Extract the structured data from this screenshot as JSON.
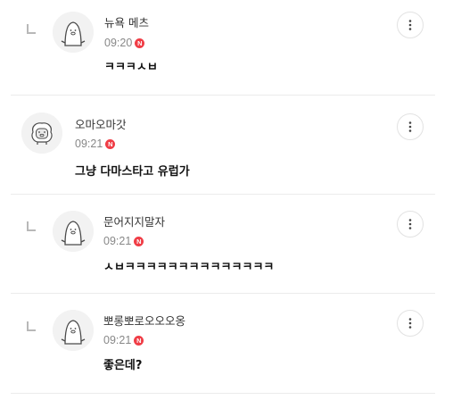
{
  "comments": [
    {
      "is_reply": true,
      "nickname": "뉴욕 메츠",
      "time": "09:20",
      "badge": "N",
      "text": "ㅋㅋㅋㅅㅂ",
      "avatar_icon": "penguin-avatar-icon",
      "menu_icon": "more-vertical-icon"
    },
    {
      "is_reply": false,
      "nickname": "오마오마갓",
      "time": "09:21",
      "badge": "N",
      "text": "그냥 다마스타고 유럽가",
      "avatar_icon": "sheep-avatar-icon",
      "menu_icon": "more-vertical-icon"
    },
    {
      "is_reply": true,
      "nickname": "문어지지말자",
      "time": "09:21",
      "badge": "N",
      "text": "ㅅㅂㅋㅋㅋㅋㅋㅋㅋㅋㅋㅋㅋㅋㅋㅋ",
      "avatar_icon": "penguin-avatar-icon",
      "menu_icon": "more-vertical-icon"
    },
    {
      "is_reply": true,
      "nickname": "뽀롱뽀로오오오옹",
      "time": "09:21",
      "badge": "N",
      "text": "좋은데?",
      "avatar_icon": "penguin-avatar-icon",
      "menu_icon": "more-vertical-icon"
    }
  ],
  "colors": {
    "badge": "#f03d46",
    "divider": "#ebebeb",
    "time": "#888888",
    "avatar_bg": "#f2f2f2"
  }
}
